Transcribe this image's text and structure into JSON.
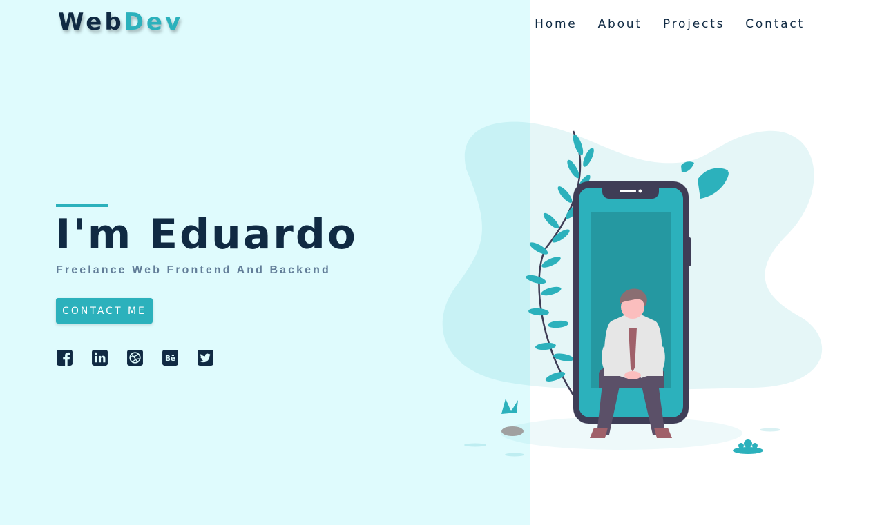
{
  "brand": {
    "part1": "Web",
    "part2": "Dev"
  },
  "nav": {
    "home": "Home",
    "about": "About",
    "projects": "Projects",
    "contact": "Contact"
  },
  "hero": {
    "title": "I'm Eduardo",
    "subtitle": "Freelance Web Frontend And Backend",
    "button": "CONTACT ME"
  },
  "social": [
    "facebook-icon",
    "linkedin-icon",
    "dribbble-icon",
    "behance-icon",
    "twitter-icon"
  ],
  "colors": {
    "primary": "#2cb1bc",
    "dark": "#102a43",
    "muted": "#627d98",
    "left_bg": "#dffbfd",
    "right_bg": "#ffffff"
  }
}
